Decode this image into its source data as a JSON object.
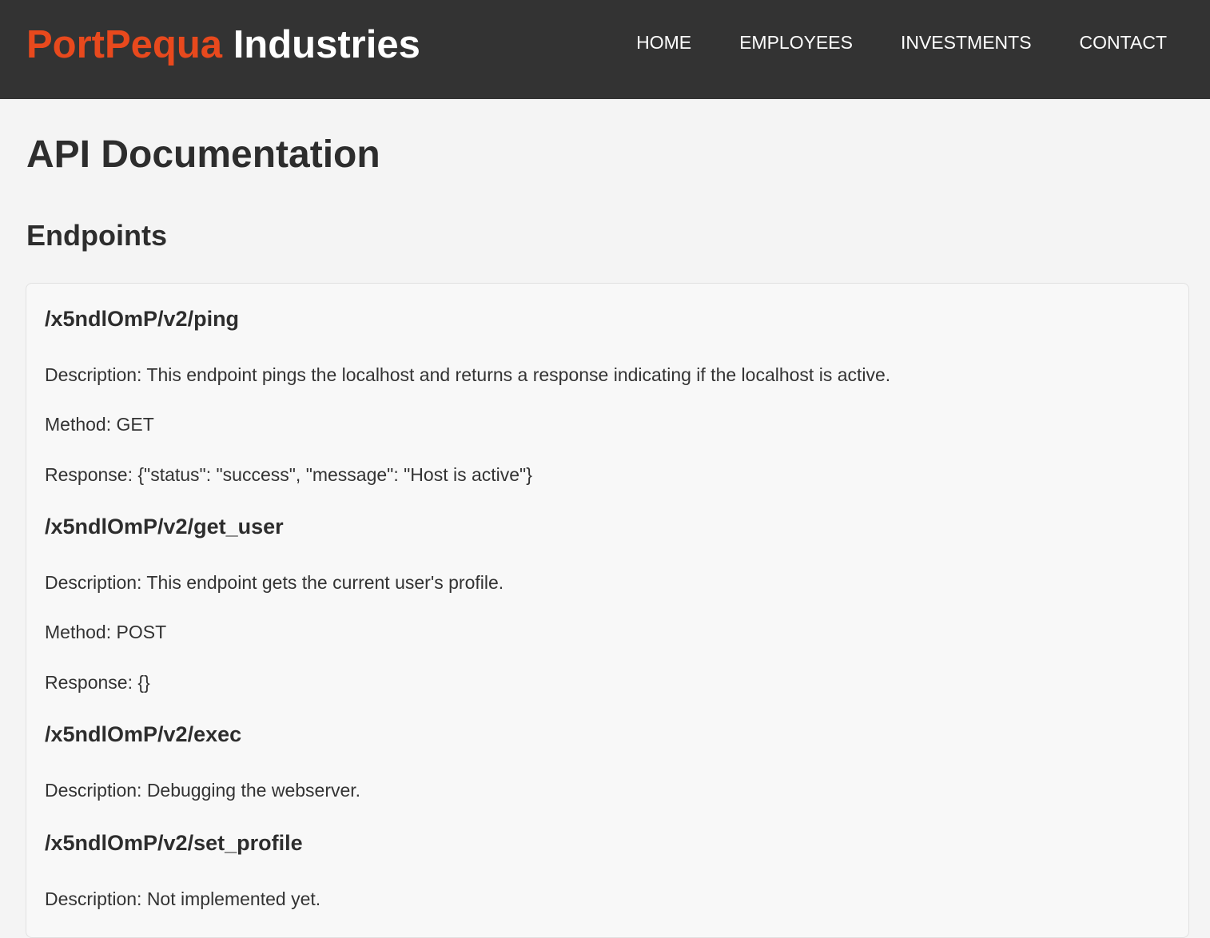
{
  "brand": {
    "accent": "PortPequa",
    "rest": "Industries"
  },
  "nav": {
    "home": "HOME",
    "employees": "EMPLOYEES",
    "investments": "INVESTMENTS",
    "contact": "CONTACT"
  },
  "page": {
    "title": "API Documentation",
    "section_title": "Endpoints"
  },
  "endpoints": [
    {
      "path": "/x5ndlOmP/v2/ping",
      "description": "Description: This endpoint pings the localhost and returns a response indicating if the localhost is active.",
      "method": "Method: GET",
      "response": "Response: {\"status\": \"success\", \"message\": \"Host is active\"}"
    },
    {
      "path": "/x5ndlOmP/v2/get_user",
      "description": "Description: This endpoint gets the current user's profile.",
      "method": "Method: POST",
      "response": "Response: {}"
    },
    {
      "path": "/x5ndlOmP/v2/exec",
      "description": "Description: Debugging the webserver."
    },
    {
      "path": "/x5ndlOmP/v2/set_profile",
      "description": "Description: Not implemented yet."
    }
  ],
  "colors": {
    "header_bg": "#333333",
    "brand_accent": "#e8491d",
    "page_bg": "#f4f4f4",
    "card_bg": "#f8f8f8",
    "card_border": "#e1e1e1"
  }
}
